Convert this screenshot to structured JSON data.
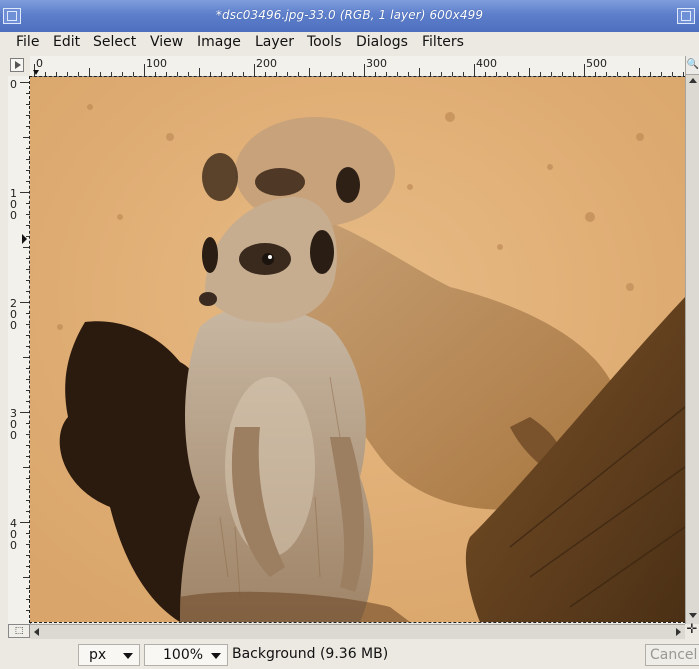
{
  "window": {
    "title": "*dsc03496.jpg-33.0 (RGB, 1 layer) 600x499"
  },
  "menu": [
    "File",
    "Edit",
    "Select",
    "View",
    "Image",
    "Layer",
    "Tools",
    "Dialogs",
    "Filters"
  ],
  "rulers": {
    "horizontal_labels": [
      "0",
      "100",
      "200",
      "300",
      "400",
      "500"
    ],
    "vertical_labels": [
      "0",
      "100",
      "200",
      "300",
      "400"
    ]
  },
  "canvas": {
    "image_description": "meerkat-photo"
  },
  "statusbar": {
    "unit": "px",
    "zoom": "100%",
    "layer_info": "Background (9.36 MB)",
    "cancel_label": "Cancel"
  },
  "colors": {
    "titlebar": "#5d7fcb",
    "sand": "#e0b079",
    "ui_bg": "#ece9e2"
  }
}
